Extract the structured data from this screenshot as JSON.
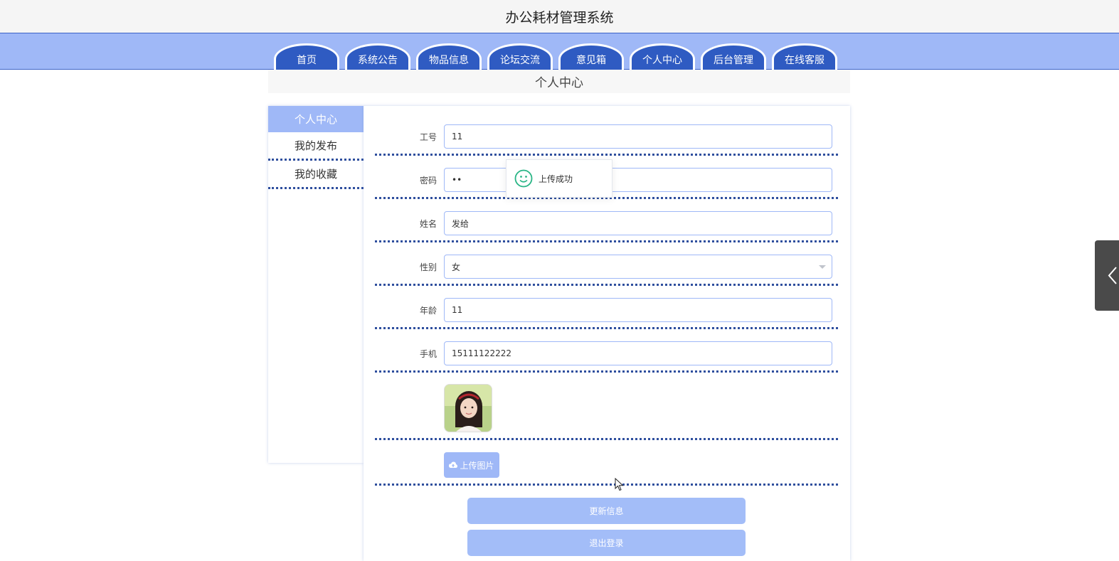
{
  "app": {
    "title": "办公耗材管理系统"
  },
  "nav": {
    "tabs": [
      "首页",
      "系统公告",
      "物品信息",
      "论坛交流",
      "意见箱",
      "个人中心",
      "后台管理",
      "在线客服"
    ]
  },
  "page": {
    "heading": "个人中心"
  },
  "sidebar": {
    "items": [
      "个人中心",
      "我的发布",
      "我的收藏"
    ],
    "active_index": 0
  },
  "form": {
    "employee_id": {
      "label": "工号",
      "value": "11"
    },
    "password": {
      "label": "密码",
      "value": "••"
    },
    "name": {
      "label": "姓名",
      "value": "发给"
    },
    "gender": {
      "label": "性别",
      "value": "女"
    },
    "age": {
      "label": "年龄",
      "value": "11"
    },
    "phone": {
      "label": "手机",
      "value": "15111122222"
    },
    "upload_label": "上传图片",
    "update_label": "更新信息",
    "logout_label": "退出登录"
  },
  "toast": {
    "message": "上传成功",
    "icon": "smile-icon"
  },
  "colors": {
    "accent": "#9fb8f7",
    "nav_tab": "#2f5bc2",
    "divider": "#2f4f9e",
    "success": "#2ab586"
  }
}
